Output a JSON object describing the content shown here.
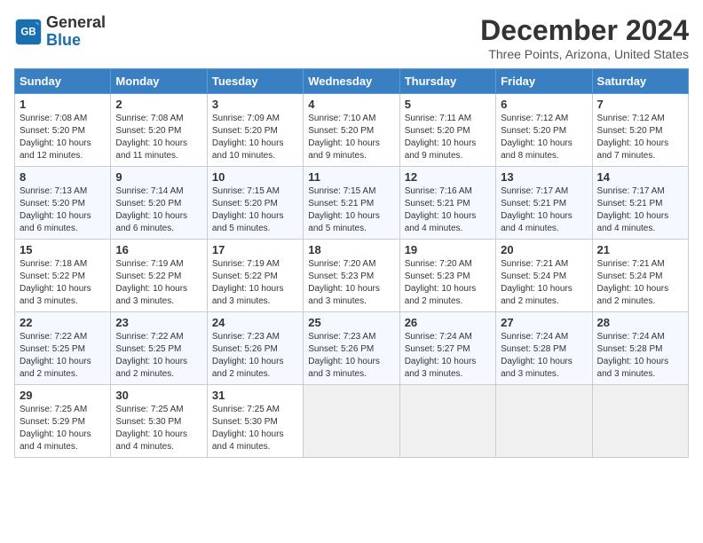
{
  "header": {
    "logo_line1": "General",
    "logo_line2": "Blue",
    "month_year": "December 2024",
    "location": "Three Points, Arizona, United States"
  },
  "days_of_week": [
    "Sunday",
    "Monday",
    "Tuesday",
    "Wednesday",
    "Thursday",
    "Friday",
    "Saturday"
  ],
  "weeks": [
    [
      {
        "day": "1",
        "sunrise": "7:08 AM",
        "sunset": "5:20 PM",
        "daylight": "10 hours and 12 minutes."
      },
      {
        "day": "2",
        "sunrise": "7:08 AM",
        "sunset": "5:20 PM",
        "daylight": "10 hours and 11 minutes."
      },
      {
        "day": "3",
        "sunrise": "7:09 AM",
        "sunset": "5:20 PM",
        "daylight": "10 hours and 10 minutes."
      },
      {
        "day": "4",
        "sunrise": "7:10 AM",
        "sunset": "5:20 PM",
        "daylight": "10 hours and 9 minutes."
      },
      {
        "day": "5",
        "sunrise": "7:11 AM",
        "sunset": "5:20 PM",
        "daylight": "10 hours and 9 minutes."
      },
      {
        "day": "6",
        "sunrise": "7:12 AM",
        "sunset": "5:20 PM",
        "daylight": "10 hours and 8 minutes."
      },
      {
        "day": "7",
        "sunrise": "7:12 AM",
        "sunset": "5:20 PM",
        "daylight": "10 hours and 7 minutes."
      }
    ],
    [
      {
        "day": "8",
        "sunrise": "7:13 AM",
        "sunset": "5:20 PM",
        "daylight": "10 hours and 6 minutes."
      },
      {
        "day": "9",
        "sunrise": "7:14 AM",
        "sunset": "5:20 PM",
        "daylight": "10 hours and 6 minutes."
      },
      {
        "day": "10",
        "sunrise": "7:15 AM",
        "sunset": "5:20 PM",
        "daylight": "10 hours and 5 minutes."
      },
      {
        "day": "11",
        "sunrise": "7:15 AM",
        "sunset": "5:21 PM",
        "daylight": "10 hours and 5 minutes."
      },
      {
        "day": "12",
        "sunrise": "7:16 AM",
        "sunset": "5:21 PM",
        "daylight": "10 hours and 4 minutes."
      },
      {
        "day": "13",
        "sunrise": "7:17 AM",
        "sunset": "5:21 PM",
        "daylight": "10 hours and 4 minutes."
      },
      {
        "day": "14",
        "sunrise": "7:17 AM",
        "sunset": "5:21 PM",
        "daylight": "10 hours and 4 minutes."
      }
    ],
    [
      {
        "day": "15",
        "sunrise": "7:18 AM",
        "sunset": "5:22 PM",
        "daylight": "10 hours and 3 minutes."
      },
      {
        "day": "16",
        "sunrise": "7:19 AM",
        "sunset": "5:22 PM",
        "daylight": "10 hours and 3 minutes."
      },
      {
        "day": "17",
        "sunrise": "7:19 AM",
        "sunset": "5:22 PM",
        "daylight": "10 hours and 3 minutes."
      },
      {
        "day": "18",
        "sunrise": "7:20 AM",
        "sunset": "5:23 PM",
        "daylight": "10 hours and 3 minutes."
      },
      {
        "day": "19",
        "sunrise": "7:20 AM",
        "sunset": "5:23 PM",
        "daylight": "10 hours and 2 minutes."
      },
      {
        "day": "20",
        "sunrise": "7:21 AM",
        "sunset": "5:24 PM",
        "daylight": "10 hours and 2 minutes."
      },
      {
        "day": "21",
        "sunrise": "7:21 AM",
        "sunset": "5:24 PM",
        "daylight": "10 hours and 2 minutes."
      }
    ],
    [
      {
        "day": "22",
        "sunrise": "7:22 AM",
        "sunset": "5:25 PM",
        "daylight": "10 hours and 2 minutes."
      },
      {
        "day": "23",
        "sunrise": "7:22 AM",
        "sunset": "5:25 PM",
        "daylight": "10 hours and 2 minutes."
      },
      {
        "day": "24",
        "sunrise": "7:23 AM",
        "sunset": "5:26 PM",
        "daylight": "10 hours and 2 minutes."
      },
      {
        "day": "25",
        "sunrise": "7:23 AM",
        "sunset": "5:26 PM",
        "daylight": "10 hours and 3 minutes."
      },
      {
        "day": "26",
        "sunrise": "7:24 AM",
        "sunset": "5:27 PM",
        "daylight": "10 hours and 3 minutes."
      },
      {
        "day": "27",
        "sunrise": "7:24 AM",
        "sunset": "5:28 PM",
        "daylight": "10 hours and 3 minutes."
      },
      {
        "day": "28",
        "sunrise": "7:24 AM",
        "sunset": "5:28 PM",
        "daylight": "10 hours and 3 minutes."
      }
    ],
    [
      {
        "day": "29",
        "sunrise": "7:25 AM",
        "sunset": "5:29 PM",
        "daylight": "10 hours and 4 minutes."
      },
      {
        "day": "30",
        "sunrise": "7:25 AM",
        "sunset": "5:30 PM",
        "daylight": "10 hours and 4 minutes."
      },
      {
        "day": "31",
        "sunrise": "7:25 AM",
        "sunset": "5:30 PM",
        "daylight": "10 hours and 4 minutes."
      },
      null,
      null,
      null,
      null
    ]
  ]
}
